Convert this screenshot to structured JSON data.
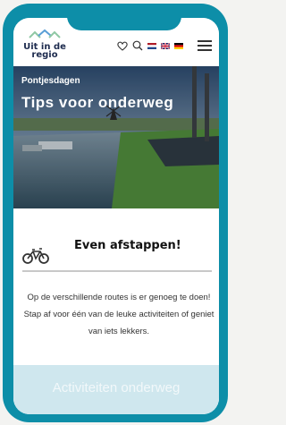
{
  "brand": {
    "line1": "Uit in de",
    "line2": "regio"
  },
  "header_icons": [
    "heart-icon",
    "search-icon",
    "flag-nl",
    "flag-uk",
    "flag-de",
    "menu-icon"
  ],
  "hero": {
    "subtitle": "Pontjesdagen",
    "title": "Tips voor onderweg"
  },
  "section": {
    "icon": "bicycle-icon",
    "title": "Even afstappen!",
    "body": "Op de verschillende routes is er genoeg te doen! Stap af voor één van de leuke activiteiten of geniet van iets lekkers."
  },
  "cta": {
    "label": "Activiteiten onderweg"
  },
  "colors": {
    "frame": "#0d8ea8",
    "brand_text": "#1d2b4e",
    "cta_bg": "#cfe7ee"
  }
}
